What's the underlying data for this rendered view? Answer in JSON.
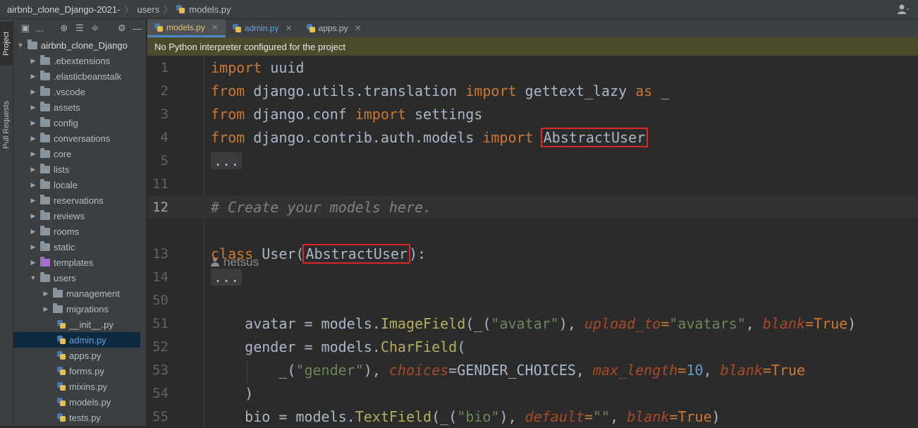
{
  "breadcrumb": {
    "project": "airbnb_clone_Django-2021-",
    "folder": "users",
    "file": "models.py"
  },
  "left_strip": {
    "project_tab": "Project",
    "pull_requests_tab": "Pull Requests"
  },
  "sidebar": {
    "toolbar_dots": "...",
    "root": "airbnb_clone_Django",
    "items": [
      {
        "label": ".ebextensions",
        "type": "folder"
      },
      {
        "label": ".elasticbeanstalk",
        "type": "folder"
      },
      {
        "label": ".vscode",
        "type": "folder"
      },
      {
        "label": "assets",
        "type": "folder"
      },
      {
        "label": "config",
        "type": "folder"
      },
      {
        "label": "conversations",
        "type": "folder"
      },
      {
        "label": "core",
        "type": "folder"
      },
      {
        "label": "lists",
        "type": "folder"
      },
      {
        "label": "locale",
        "type": "folder"
      },
      {
        "label": "reservations",
        "type": "folder"
      },
      {
        "label": "reviews",
        "type": "folder"
      },
      {
        "label": "rooms",
        "type": "folder"
      },
      {
        "label": "static",
        "type": "folder"
      },
      {
        "label": "templates",
        "type": "folder"
      },
      {
        "label": "users",
        "type": "folder"
      },
      {
        "label": "management",
        "type": "folder"
      },
      {
        "label": "migrations",
        "type": "folder"
      },
      {
        "label": "__init__.py",
        "type": "file"
      },
      {
        "label": "admin.py",
        "type": "file"
      },
      {
        "label": "apps.py",
        "type": "file"
      },
      {
        "label": "forms.py",
        "type": "file"
      },
      {
        "label": "mixins.py",
        "type": "file"
      },
      {
        "label": "models.py",
        "type": "file"
      },
      {
        "label": "tests.py",
        "type": "file"
      }
    ]
  },
  "tabs": [
    {
      "label": "models.py",
      "active": true
    },
    {
      "label": "admin.py",
      "active": false
    },
    {
      "label": "apps.py",
      "active": false
    }
  ],
  "banner": "No Python interpreter configured for the project",
  "code": {
    "line_numbers": [
      "1",
      "2",
      "3",
      "4",
      "5",
      "11",
      "12",
      "13",
      "14",
      "50",
      "51",
      "52",
      "53",
      "54",
      "55"
    ],
    "author": "netsus",
    "l1": [
      "import",
      " uuid"
    ],
    "l2": [
      "from",
      " django.utils.translation ",
      "import",
      " gettext_lazy ",
      "as",
      " _"
    ],
    "l3": [
      "from",
      " django.conf ",
      "import",
      " settings"
    ],
    "l4": [
      "from",
      " django.contrib.auth.models ",
      "import",
      " ",
      "AbstractUser"
    ],
    "l5": "...",
    "l12": "# Create your models here.",
    "l13": [
      "class",
      " User(",
      "AbstractUser",
      "):"
    ],
    "l14": "...",
    "l51": [
      "    avatar = models.",
      "ImageField",
      "(_(",
      "\"avatar\"",
      "), ",
      "upload_to",
      "=",
      "\"avatars\"",
      ", ",
      "blank",
      "=",
      "True",
      ")"
    ],
    "l52": [
      "    gender = models.",
      "CharField",
      "("
    ],
    "l53": [
      "        _(",
      "\"gender\"",
      "), ",
      "choices",
      "=GENDER_CHOICES, ",
      "max_length",
      "=",
      "10",
      ", ",
      "blank",
      "=",
      "True"
    ],
    "l54": "    )",
    "l55": [
      "    bio = models.",
      "TextField",
      "(_(",
      "\"bio\"",
      "), ",
      "default",
      "=",
      "\"\"",
      ", ",
      "blank",
      "=",
      "True",
      ")"
    ]
  },
  "colors": {
    "keyword": "#cc7832",
    "string": "#6a8759",
    "comment": "#808080",
    "highlight_box": "#d92828",
    "banner": "#4b4a2c"
  }
}
